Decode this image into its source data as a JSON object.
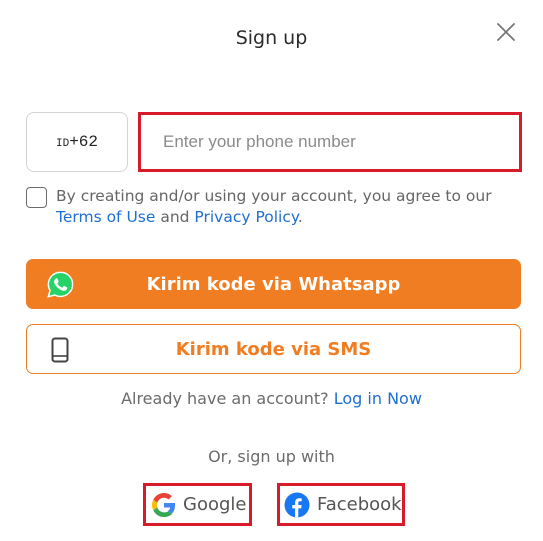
{
  "header": {
    "title": "Sign up",
    "close_icon": "close-icon"
  },
  "phone": {
    "country_code": "ID",
    "dial_code": "+62",
    "placeholder": "Enter your phone number",
    "value": ""
  },
  "agreement": {
    "checked": false,
    "text_before": "By creating and/or using your account, you agree to our ",
    "terms_label": "Terms of Use",
    "text_middle": " and ",
    "privacy_label": "Privacy Policy",
    "text_after": "."
  },
  "buttons": {
    "whatsapp_label": "Kirim kode via Whatsapp",
    "whatsapp_icon": "whatsapp-icon",
    "sms_label": "Kirim kode via SMS",
    "sms_icon": "phone-icon"
  },
  "login_prompt": {
    "text": "Already have an account? ",
    "link_label": "Log in Now"
  },
  "social": {
    "heading": "Or, sign up with",
    "google_label": "Google",
    "google_icon": "google-icon",
    "facebook_label": "Facebook",
    "facebook_icon": "facebook-icon"
  },
  "colors": {
    "accent_orange": "#f07d22",
    "link_blue": "#1f6fd1",
    "highlight_red": "#d81b2b",
    "whatsapp_green": "#25d366",
    "facebook_blue": "#1877f2"
  }
}
